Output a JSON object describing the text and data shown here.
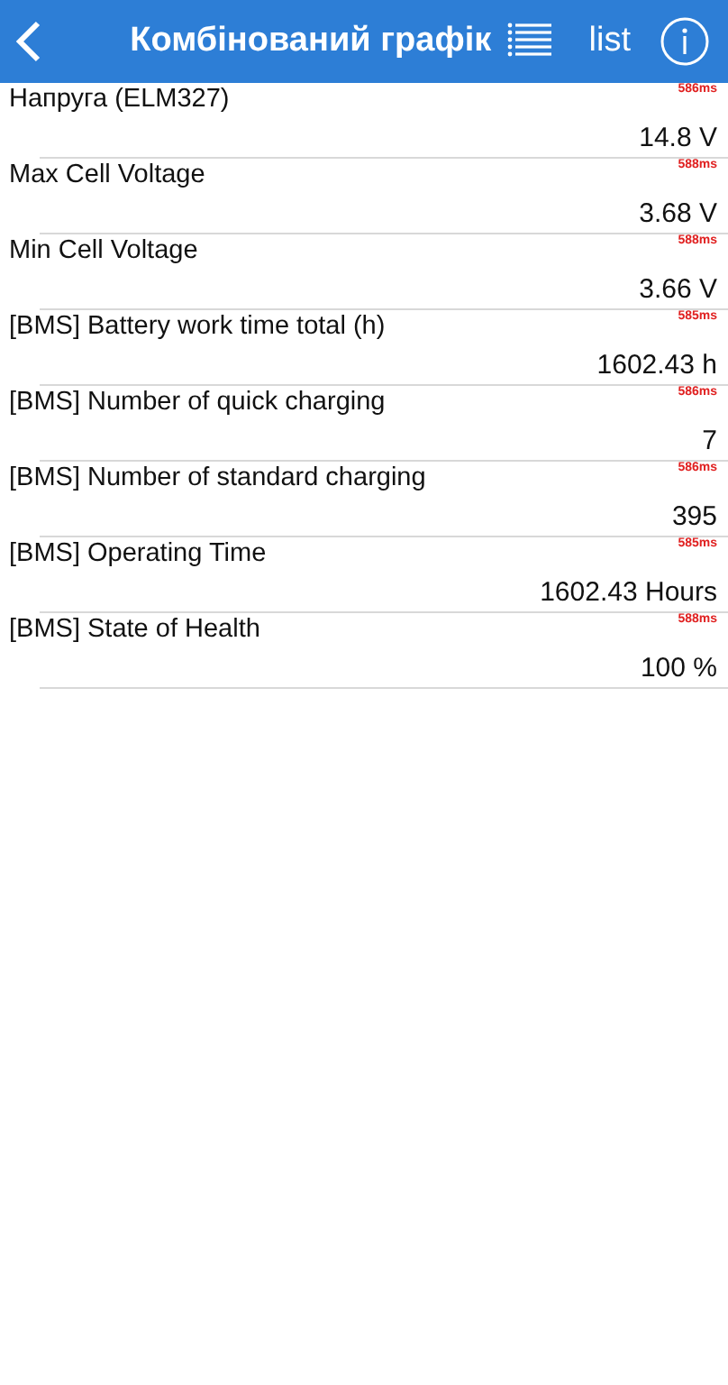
{
  "header": {
    "title": "Комбінований графік",
    "list_label": "list"
  },
  "rows": [
    {
      "name": "Напруга (ELM327)",
      "latency": "586ms",
      "value": "14.8 V"
    },
    {
      "name": "Max Cell Voltage",
      "latency": "588ms",
      "value": "3.68 V"
    },
    {
      "name": "Min Cell Voltage",
      "latency": "588ms",
      "value": "3.66 V"
    },
    {
      "name": "[BMS] Battery work time total (h)",
      "latency": "585ms",
      "value": "1602.43 h"
    },
    {
      "name": "[BMS] Number of quick charging",
      "latency": "586ms",
      "value": "7"
    },
    {
      "name": "[BMS] Number of standard charging",
      "latency": "586ms",
      "value": "395"
    },
    {
      "name": "[BMS] Operating Time",
      "latency": "585ms",
      "value": "1602.43 Hours"
    },
    {
      "name": "[BMS] State of Health",
      "latency": "588ms",
      "value": "100 %"
    }
  ]
}
